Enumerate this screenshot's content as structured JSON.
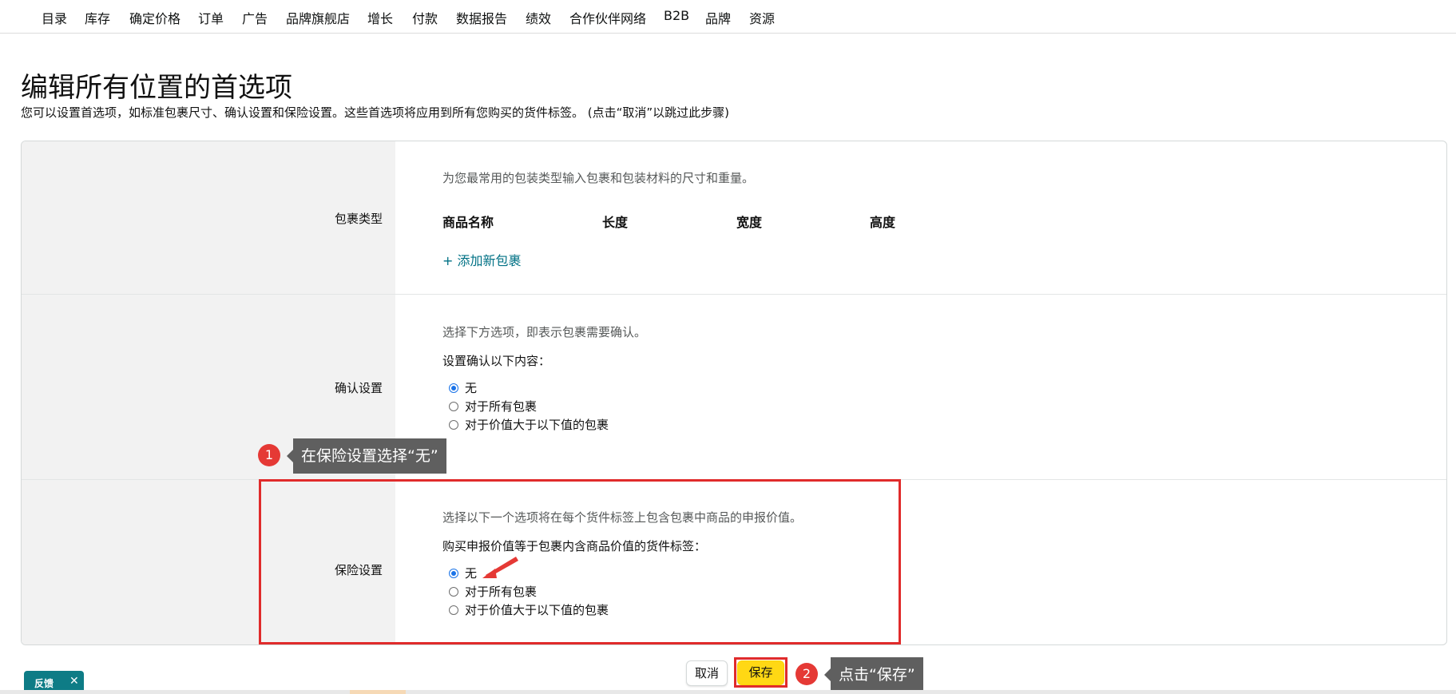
{
  "nav": {
    "items": [
      "目录",
      "库存",
      "确定价格",
      "订单",
      "广告",
      "品牌旗舰店",
      "增长",
      "付款",
      "数据报告",
      "绩效",
      "合作伙伴网络",
      "B2B",
      "品牌",
      "资源"
    ]
  },
  "page": {
    "title": "编辑所有位置的首选项",
    "description": "您可以设置首选项，如标准包裹尺寸、确认设置和保险设置。这些首选项将应用到所有您购买的货件标签。 (点击“取消”以跳过此步骤)"
  },
  "package_section": {
    "label": "包裹类型",
    "hint": "为您最常用的包装类型输入包裹和包装材料的尺寸和重量。",
    "columns": [
      "商品名称",
      "长度",
      "宽度",
      "高度"
    ],
    "add_link": "+ 添加新包裹"
  },
  "confirm_section": {
    "label": "确认设置",
    "hint": "选择下方选项，即表示包裹需要确认。",
    "prompt": "设置确认以下内容：",
    "options": [
      "无",
      "对于所有包裹",
      "对于价值大于以下值的包裹"
    ],
    "selected": "无"
  },
  "insurance_section": {
    "label": "保险设置",
    "hint": "选择以下一个选项将在每个货件标签上包含包裹中商品的申报价值。",
    "prompt": "购买申报价值等于包裹内含商品价值的货件标签：",
    "options": [
      "无",
      "对于所有包裹",
      "对于价值大于以下值的包裹"
    ],
    "selected": "无"
  },
  "annotations": {
    "step1_number": "1",
    "step1_text": "在保险设置选择“无”",
    "step2_number": "2",
    "step2_text": "点击“保存”",
    "highlight_color": "#e02b2b"
  },
  "actions": {
    "cancel_label": "取消",
    "save_label": "保存",
    "save_color": "#ffd814"
  },
  "feedback": {
    "label": "反馈",
    "close": "✕",
    "color": "#0e7c86"
  }
}
